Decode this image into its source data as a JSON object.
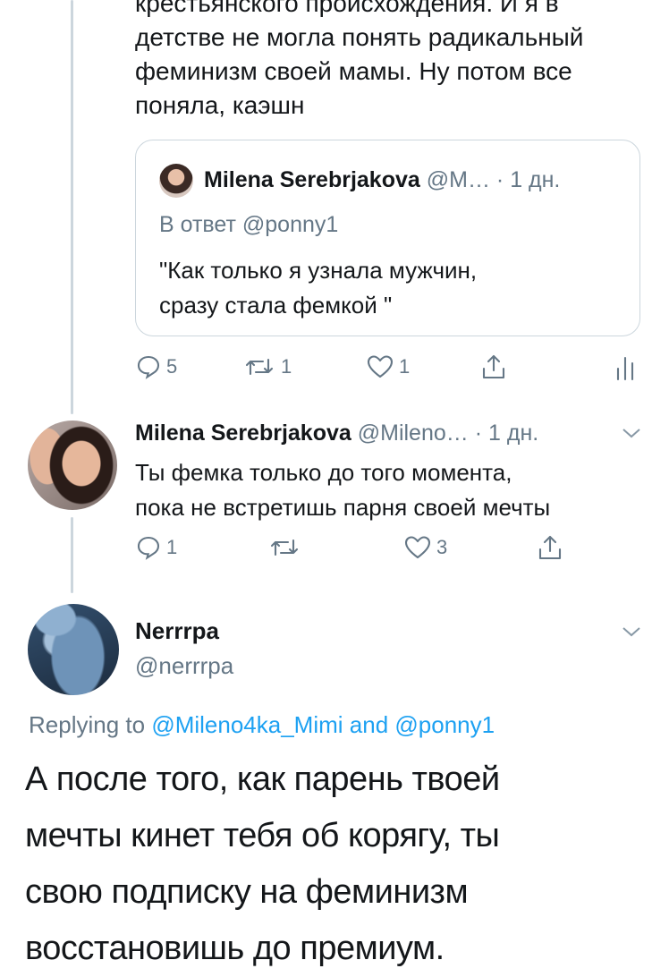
{
  "top_tweet": {
    "text_lines": [
      "крестьянского происхождения. И я в",
      "детстве не могла понять радикальный",
      "феминизм своей мамы. Ну потом все",
      "поняла, каэшн"
    ],
    "quote": {
      "name": "Milena Serebrjakova",
      "handle": "@M…",
      "time": "· 1 дн.",
      "reply_to": "В ответ @ponny1",
      "text_lines": [
        "\"Как только я узнала мужчин,",
        "сразу стала фемкой \""
      ]
    },
    "actions": {
      "replies": "5",
      "retweets": "1",
      "likes": "1"
    }
  },
  "reply1": {
    "name": "Milena Serebrjakova",
    "handle": "@Mileno…",
    "time": "· 1 дн.",
    "text_lines": [
      "Ты фемка только до того момента,",
      "пока не встретишь парня своей мечты"
    ],
    "actions": {
      "replies": "1",
      "retweets": "",
      "likes": "3"
    }
  },
  "main_tweet": {
    "name": "Nerrrpa",
    "handle": "@nerrrpa",
    "replying_prefix": "Replying to",
    "replying_user1": "@Mileno4ka_Mimi",
    "replying_and": "and",
    "replying_user2": "@ponny1",
    "text_lines": [
      "А после того, как парень твоей",
      "мечты кинет тебя об корягу, ты",
      "свою подписку на феминизм",
      "восстановишь до премиум."
    ]
  },
  "colors": {
    "link": "#1da1f2",
    "muted": "#657786",
    "thread_line": "#ccd6dd"
  }
}
